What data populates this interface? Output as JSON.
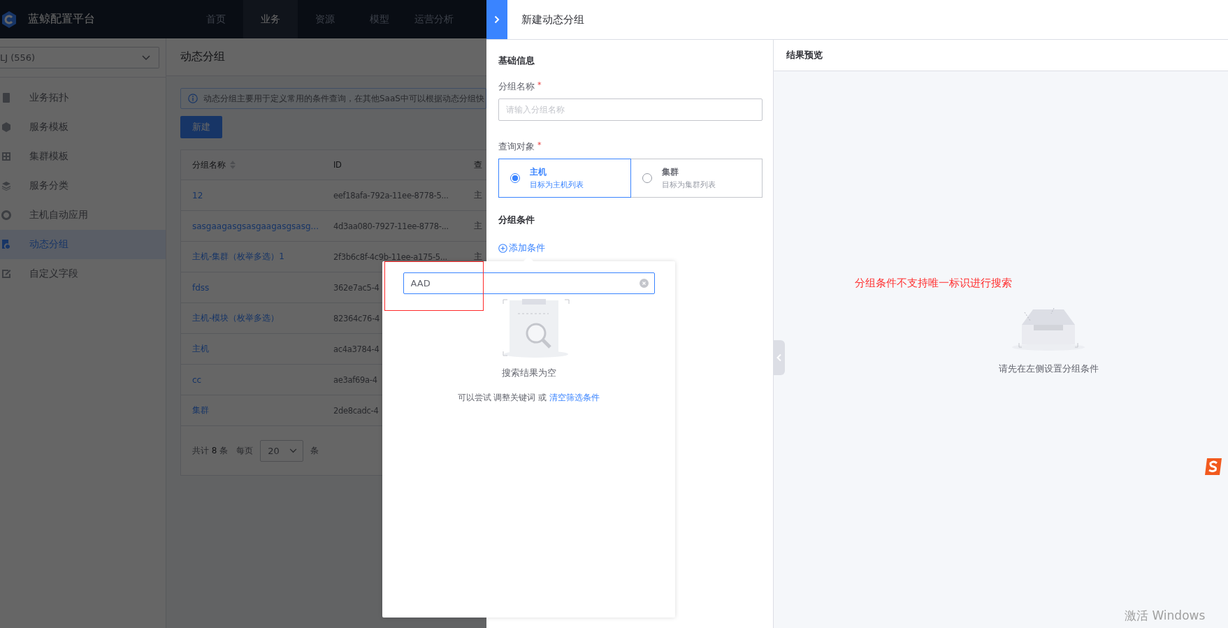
{
  "top_nav": {
    "title": "蓝鲸配置平台",
    "items": [
      {
        "label": "首页",
        "selected": false
      },
      {
        "label": "业务",
        "selected": true
      },
      {
        "label": "资源",
        "selected": false
      },
      {
        "label": "模型",
        "selected": false
      },
      {
        "label": "运营分析",
        "selected": false
      }
    ]
  },
  "sidebar": {
    "business_select": "LJ (556)",
    "items": [
      {
        "label": "业务拓扑",
        "selected": false
      },
      {
        "label": "服务模板",
        "selected": false
      },
      {
        "label": "集群模板",
        "selected": false
      },
      {
        "label": "服务分类",
        "selected": false
      },
      {
        "label": "主机自动应用",
        "selected": false
      },
      {
        "label": "动态分组",
        "selected": true
      },
      {
        "label": "自定义字段",
        "selected": false
      }
    ]
  },
  "page": {
    "title": "动态分组",
    "notice": "动态分组主要用于定义常用的条件查询，在其他SaaS中可以根据动态分组快",
    "new_button": "新建",
    "table": {
      "columns": [
        "分组名称",
        "ID",
        "查"
      ],
      "rows": [
        {
          "name": "12",
          "id": "eef18afa-792a-11ee-8778-5...",
          "column_3": "主"
        },
        {
          "name": "sasgaagasgsasgaagasgsasg...",
          "id": "4d3aa080-7927-11ee-8778-...",
          "column_3": "主"
        },
        {
          "name": "主机-集群（枚举多选）1",
          "id": "2f3b6c8f-4c9b-11ee-a175-5...",
          "column_3": "主"
        },
        {
          "name": "fdss",
          "id": "362e7ac5-4"
        },
        {
          "name": "主机-模块（枚举多选）",
          "id": "82364c76-4"
        },
        {
          "name": "主机",
          "id": "ac4a3784-4"
        },
        {
          "name": "cc",
          "id": "ae3af69a-4"
        },
        {
          "name": "集群",
          "id": "2de8cadc-4"
        }
      ]
    },
    "pagination": {
      "total_prefix": "共计",
      "total": "8",
      "total_suffix": "条",
      "per_page_label": "每页",
      "page_size": "20",
      "per_page_suffix": "条"
    }
  },
  "drawer": {
    "title": "新建动态分组",
    "basic_section": "基础信息",
    "name_label": {
      "text": "分组名称",
      "required_mark": "*"
    },
    "name_placeholder": "请输入分组名称",
    "target_label": {
      "text": "查询对象",
      "required_mark": "*"
    },
    "targets": [
      {
        "title": "主机",
        "subtitle": "目标为主机列表",
        "selected": true
      },
      {
        "title": "集群",
        "subtitle": "目标为集群列表",
        "selected": false
      }
    ],
    "condition_section": "分组条件",
    "add_condition": "添加条件"
  },
  "field_popover": {
    "search_value": "AAD",
    "empty_title": "搜索结果为空",
    "hint_prefix": "可以尝试 调整关键词 或",
    "clear_link": "清空筛选条件"
  },
  "preview": {
    "title": "结果预览",
    "empty_text": "请先在左侧设置分组条件"
  },
  "annotation": {
    "note": "分组条件不支持唯一标识进行搜索"
  },
  "os_notice": "激活 Windows"
}
